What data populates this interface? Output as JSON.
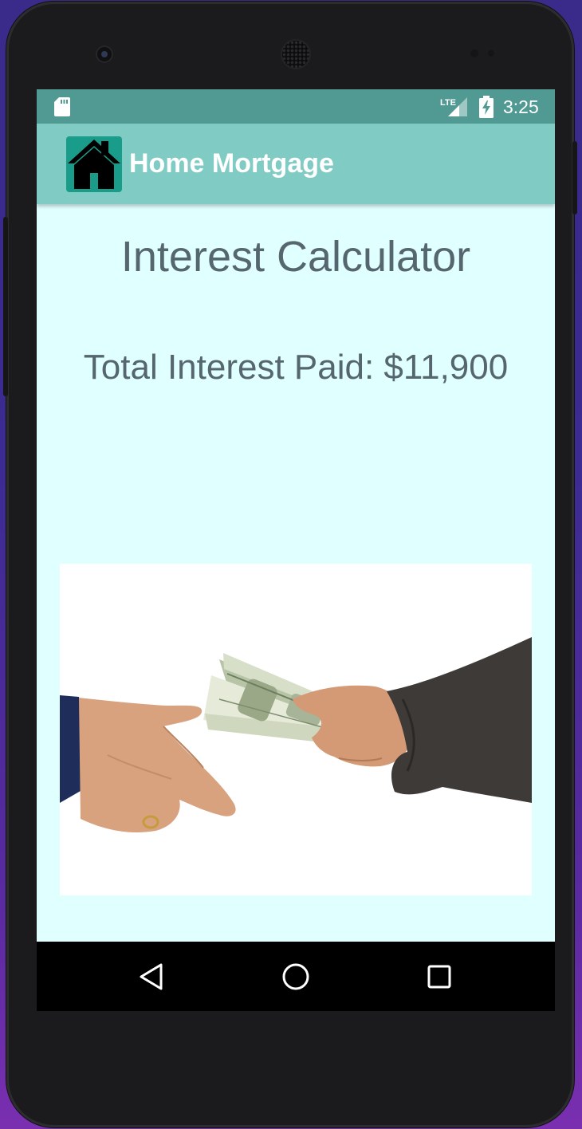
{
  "status_bar": {
    "time": "3:25",
    "network_label": "LTE",
    "icons": [
      "sd-card-icon",
      "lte-signal-icon",
      "battery-charging-icon"
    ]
  },
  "app_bar": {
    "title": "Home Mortgage",
    "logo_icon": "house-icon"
  },
  "main": {
    "heading": "Interest Calculator",
    "total_interest_label": "Total Interest Paid: $11,900",
    "image_subject": "hands-passing-dollar-bills"
  },
  "nav_bar": {
    "buttons": [
      "back-icon",
      "home-icon",
      "recents-icon"
    ]
  },
  "colors": {
    "status_bar": "#519a94",
    "app_bar": "#80cbc4",
    "screen_background": "#e0ffff",
    "text": "#56666f"
  }
}
